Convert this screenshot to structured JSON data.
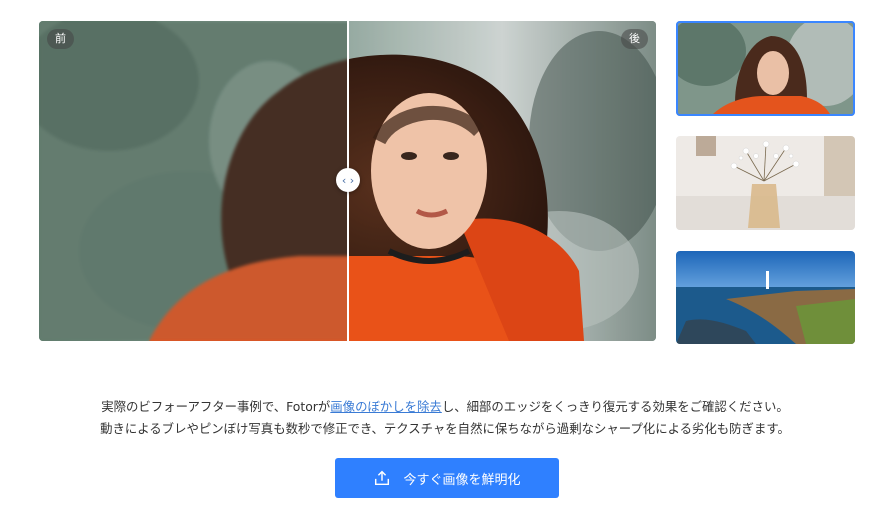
{
  "comparison": {
    "before_label": "前",
    "after_label": "後",
    "slider_handle": "‹ ›",
    "slider_position": 0.5
  },
  "thumbnails": [
    {
      "subject": "woman-portrait",
      "selected": true
    },
    {
      "subject": "flower-vase",
      "selected": false
    },
    {
      "subject": "coastline-lighthouse",
      "selected": false
    }
  ],
  "description": {
    "line1_before": "実際のビフォーアフター事例で、Fotorが",
    "line1_link": "画像のぼかしを除去",
    "line1_after": "し、細部のエッジをくっきり復元する効果をご確認ください。",
    "line2": "動きによるブレやピンぼけ写真も数秒で修正でき、テクスチャを自然に保ちながら過剰なシャープ化による劣化も防ぎます。"
  },
  "cta": {
    "label": "今すぐ画像を鮮明化",
    "icon": "upload-icon"
  },
  "colors": {
    "accent": "#2f80ff",
    "link": "#3a7bd5",
    "selected_outline": "#3a86ff"
  }
}
